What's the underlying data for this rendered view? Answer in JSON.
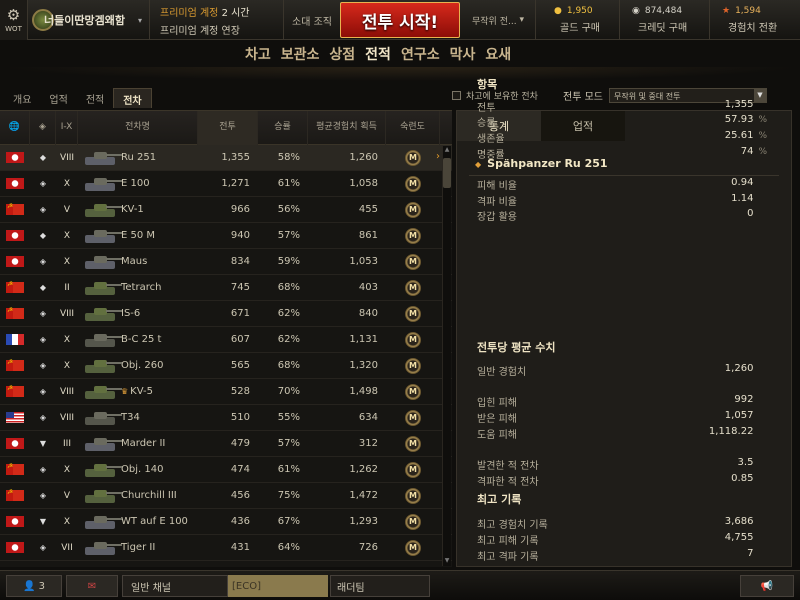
{
  "topbar": {
    "logo_label": "WOT",
    "account_name": "너들이딴망겜왜함",
    "premium": {
      "line1_prefix": "프리미엄 계정 ",
      "line1_value": "2 시간",
      "line2": "프리미엄 계정 연장"
    },
    "unit_label": "소대 조직",
    "battle_button": "전투 시작!",
    "battle_mode": "무작위 전...",
    "gold": {
      "value": "1,950",
      "button": "골드 구매",
      "color": "#f0c040"
    },
    "credits": {
      "value": "874,484",
      "button": "크레딧 구매"
    },
    "free_xp": {
      "value": "1,594",
      "button": "경험치 전환"
    }
  },
  "main_menu": [
    "차고",
    "보관소",
    "상점",
    "전적",
    "연구소",
    "막사",
    "요새"
  ],
  "main_menu_active": "전적",
  "sub_tabs": [
    "개요",
    "업적",
    "전적",
    "전차"
  ],
  "sub_tab_active": "전차",
  "owned_filter_label": "차고에 보유한 전차",
  "battle_mode_filter": {
    "label": "전투 모드",
    "selected": "무작위 및 중대 전투"
  },
  "table": {
    "headers": [
      "",
      "",
      "I-X",
      "전차명",
      "전투",
      "승률",
      "평균\n경험치 획득",
      "숙련도"
    ],
    "rows": [
      {
        "nation": "de",
        "type": "◆",
        "tier": "VIII",
        "name": "Ru 251",
        "battles": "1,355",
        "winrate": "58%",
        "avgxp": "1,260",
        "premium": false
      },
      {
        "nation": "de",
        "type": "◈",
        "tier": "X",
        "name": "E 100",
        "battles": "1,271",
        "winrate": "61%",
        "avgxp": "1,058",
        "premium": false
      },
      {
        "nation": "ru",
        "type": "◈",
        "tier": "V",
        "name": "KV-1",
        "battles": "966",
        "winrate": "56%",
        "avgxp": "455",
        "premium": false
      },
      {
        "nation": "de",
        "type": "◆",
        "tier": "X",
        "name": "E 50 M",
        "battles": "940",
        "winrate": "57%",
        "avgxp": "861",
        "premium": false
      },
      {
        "nation": "de",
        "type": "◈",
        "tier": "X",
        "name": "Maus",
        "battles": "834",
        "winrate": "59%",
        "avgxp": "1,053",
        "premium": false
      },
      {
        "nation": "ru",
        "type": "◆",
        "tier": "II",
        "name": "Tetrarch",
        "battles": "745",
        "winrate": "68%",
        "avgxp": "403",
        "premium": false
      },
      {
        "nation": "ru",
        "type": "◈",
        "tier": "VIII",
        "name": "IS-6",
        "battles": "671",
        "winrate": "62%",
        "avgxp": "840",
        "premium": false
      },
      {
        "nation": "fr",
        "type": "◈",
        "tier": "X",
        "name": "B-C 25 t",
        "battles": "607",
        "winrate": "62%",
        "avgxp": "1,131",
        "premium": false
      },
      {
        "nation": "ru",
        "type": "◈",
        "tier": "X",
        "name": "Obj. 260",
        "battles": "565",
        "winrate": "68%",
        "avgxp": "1,320",
        "premium": false
      },
      {
        "nation": "ru",
        "type": "◈",
        "tier": "VIII",
        "name": "KV-5",
        "battles": "528",
        "winrate": "70%",
        "avgxp": "1,498",
        "premium": true
      },
      {
        "nation": "us",
        "type": "◈",
        "tier": "VIII",
        "name": "T34",
        "battles": "510",
        "winrate": "55%",
        "avgxp": "634",
        "premium": false
      },
      {
        "nation": "de",
        "type": "▼",
        "tier": "III",
        "name": "Marder II",
        "battles": "479",
        "winrate": "57%",
        "avgxp": "312",
        "premium": false
      },
      {
        "nation": "ru",
        "type": "◈",
        "tier": "X",
        "name": "Obj. 140",
        "battles": "474",
        "winrate": "61%",
        "avgxp": "1,262",
        "premium": false
      },
      {
        "nation": "ru",
        "type": "◈",
        "tier": "V",
        "name": "Churchill III",
        "battles": "456",
        "winrate": "75%",
        "avgxp": "1,472",
        "premium": false
      },
      {
        "nation": "de",
        "type": "▼",
        "tier": "X",
        "name": "WT auf E 100",
        "battles": "436",
        "winrate": "67%",
        "avgxp": "1,293",
        "premium": false
      },
      {
        "nation": "de",
        "type": "◈",
        "tier": "VII",
        "name": "Tiger II",
        "battles": "431",
        "winrate": "64%",
        "avgxp": "726",
        "premium": false
      }
    ],
    "mastery_label": "M"
  },
  "stats": {
    "tabs": [
      "통계",
      "업적"
    ],
    "tab_active": "통계",
    "tank_name": "Späh­panzer Ru 251",
    "sections": [
      {
        "title": "항목",
        "rows": [
          {
            "label": "전투",
            "value": "1,355",
            "pct": ""
          },
          {
            "label": "승률",
            "value": "57.93",
            "pct": "%"
          },
          {
            "label": "생존율",
            "value": "25.61",
            "pct": "%"
          },
          {
            "label": "명중률",
            "value": "74",
            "pct": "%"
          },
          {
            "label": "피해 비율",
            "value": "0.94",
            "pct": ""
          },
          {
            "label": "격파 비율",
            "value": "1.14",
            "pct": ""
          },
          {
            "label": "장갑 활용",
            "value": "0",
            "pct": ""
          }
        ]
      },
      {
        "title": "전투당 평균 수치",
        "rows": [
          {
            "label": "일반 경험치",
            "value": "1,260",
            "pct": ""
          },
          {
            "label": "입힌 피해",
            "value": "992",
            "pct": ""
          },
          {
            "label": "받은 피해",
            "value": "1,057",
            "pct": ""
          },
          {
            "label": "도움 피해",
            "value": "1,118.22",
            "pct": ""
          },
          {
            "label": "발견한 적 전차",
            "value": "3.5",
            "pct": ""
          },
          {
            "label": "격파한 적 전차",
            "value": "0.85",
            "pct": ""
          }
        ]
      },
      {
        "title": "최고 기록",
        "rows": [
          {
            "label": "최고 경험치 기록",
            "value": "3,686",
            "pct": ""
          },
          {
            "label": "최고 피해 기록",
            "value": "4,755",
            "pct": ""
          },
          {
            "label": "최고 격파 기록",
            "value": "7",
            "pct": ""
          }
        ]
      }
    ]
  },
  "bottombar": {
    "friends_count": "3",
    "channel": "일반 채널",
    "eco": "[ECO]",
    "ladder": "래더팀"
  }
}
